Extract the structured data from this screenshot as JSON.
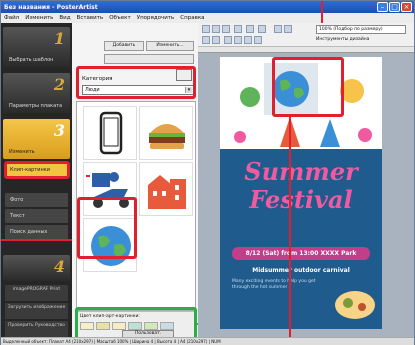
{
  "window": {
    "title": "Без названия - PosterArtist"
  },
  "menu": [
    "Файл",
    "Изменить",
    "Вид",
    "Вставить",
    "Объект",
    "Упорядочить",
    "Справка"
  ],
  "steps": [
    {
      "num": "1",
      "label": "Выбрать шаблон"
    },
    {
      "num": "2",
      "label": "Параметры плаката"
    },
    {
      "num": "3",
      "label": "Изменить"
    },
    {
      "num": "4",
      "label": ""
    }
  ],
  "sub_items": {
    "clipart": "Клип-картинки",
    "photos": "Фото",
    "text": "Текст",
    "fill": "Поиск данных"
  },
  "bottom_buttons": [
    "imagePROGRAF Print",
    "Загрузить изображение",
    "Проверить Руководство"
  ],
  "mid_buttons": {
    "add": "Добавить",
    "edit": "Изменить..."
  },
  "category": {
    "label": "Категория",
    "value": "Люди"
  },
  "clip_color": {
    "label": "Цвет клип-арт-картинки:",
    "reset": "Пользоват."
  },
  "toolbar": {
    "zoom": "100% (Подбор по размеру)",
    "instruction": "Инструменты дизайна"
  },
  "poster": {
    "title1": "Summer",
    "title2": "Festival",
    "date": "8/12 (Sat) from 13:00 XXXX Park",
    "subtitle": "Midsummer outdoor carnival",
    "desc": "Many exciting events to help you get through the hot summer"
  },
  "status": "Выделенный объект: Плакат A4 (210x297) | Масштаб 100% | Ширина 4 | Высота 4 | A4 (210x297) | NUM"
}
